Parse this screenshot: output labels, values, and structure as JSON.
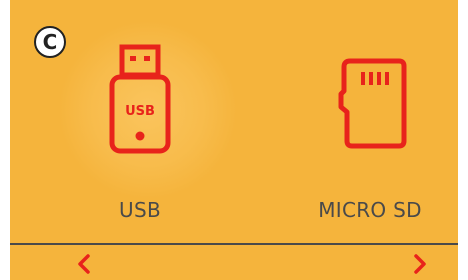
{
  "badge": {
    "letter": "C"
  },
  "options": [
    {
      "label": "USB",
      "icon": "usb-drive-icon",
      "icon_text": "USB"
    },
    {
      "label": "MICRO SD",
      "icon": "micro-sd-card-icon"
    }
  ],
  "navigation": {
    "prev_icon": "chevron-left-icon",
    "next_icon": "chevron-right-icon"
  },
  "colors": {
    "background": "#f5b43c",
    "accent": "#e8231b",
    "text": "#4a4a4a",
    "divider": "#4a4a4a"
  }
}
